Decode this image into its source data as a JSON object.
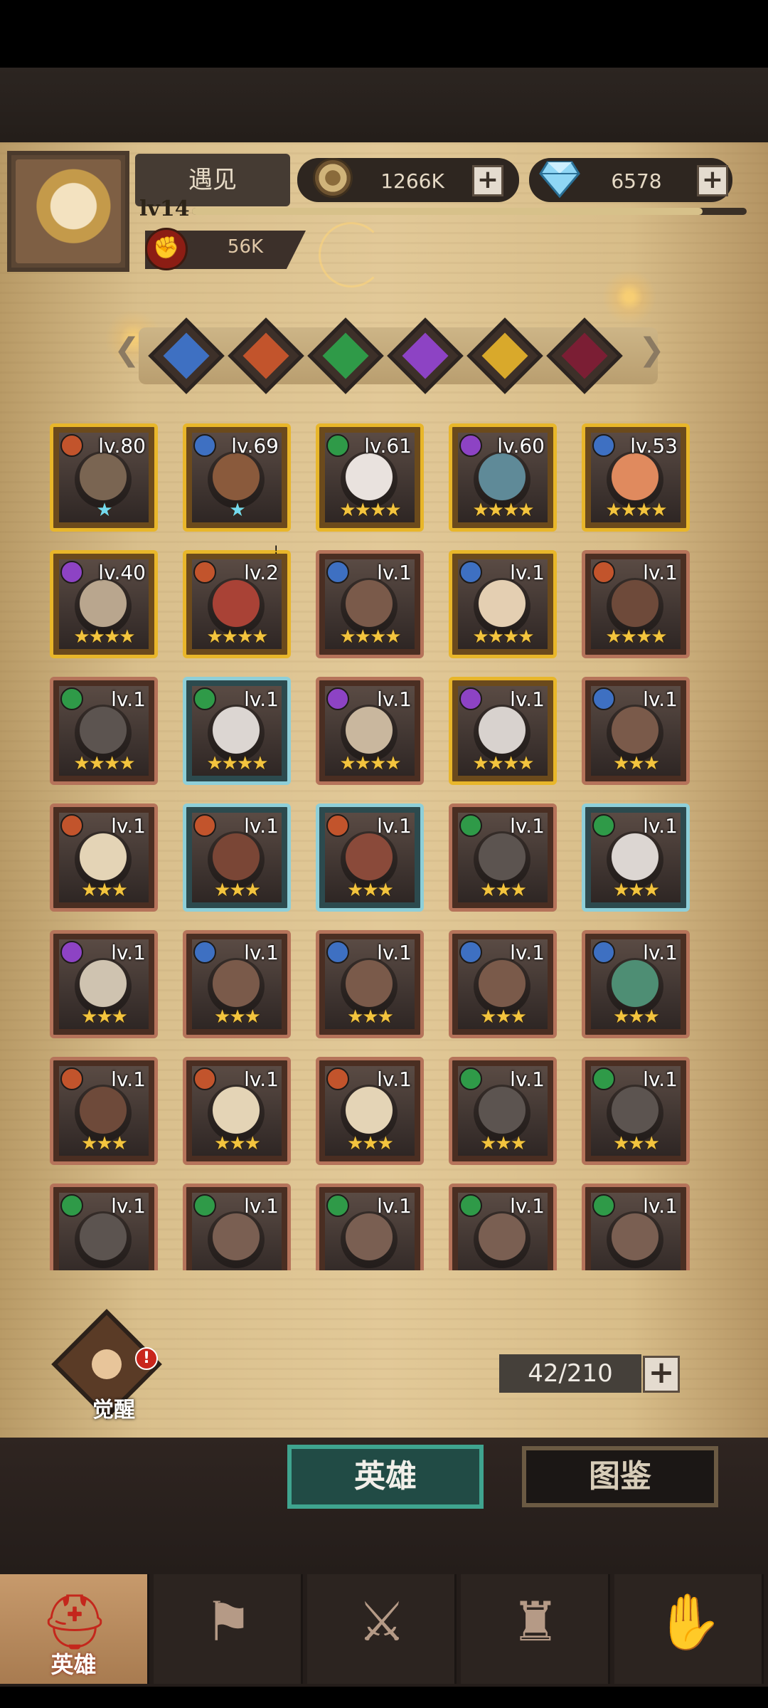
{
  "player": {
    "name": "遇见",
    "level": "lv14",
    "xp_fraction": 0.92,
    "power": "56K"
  },
  "resources": {
    "gold": "1266K",
    "gems": "6578",
    "plus": "+"
  },
  "filters": [
    {
      "name": "class-1",
      "color": "#3e70c2"
    },
    {
      "name": "class-2",
      "color": "#c2542c"
    },
    {
      "name": "class-3",
      "color": "#2f9a48"
    },
    {
      "name": "class-4",
      "color": "#8d43c4"
    },
    {
      "name": "class-5",
      "color": "#d9a92b"
    },
    {
      "name": "class-6",
      "color": "#7b1e34"
    }
  ],
  "heroes": [
    {
      "level": "lv.80",
      "stars": "★",
      "star_color": "blue",
      "frame": "gold",
      "cls": "#c2542c",
      "face": "#7a6552"
    },
    {
      "level": "lv.69",
      "stars": "★",
      "star_color": "blue",
      "frame": "gold",
      "cls": "#3e70c2",
      "face": "#8a5a3c"
    },
    {
      "level": "lv.61",
      "stars": "★★★★",
      "star_color": "gold",
      "frame": "gold",
      "cls": "#2f9a48",
      "face": "#e9e2de"
    },
    {
      "level": "lv.60",
      "stars": "★★★★",
      "star_color": "gold",
      "frame": "gold",
      "cls": "#8d43c4",
      "face": "#5f8a98"
    },
    {
      "level": "lv.53",
      "stars": "★★★★",
      "star_color": "gold",
      "frame": "gold",
      "cls": "#3e70c2",
      "face": "#e08a5e"
    },
    {
      "level": "lv.40",
      "stars": "★★★★",
      "star_color": "gold",
      "frame": "gold",
      "cls": "#8d43c4",
      "face": "#b9a68e"
    },
    {
      "level": "lv.2",
      "stars": "★★★★",
      "star_color": "gold",
      "frame": "gold",
      "cls": "#c2542c",
      "face": "#a94236",
      "badge": "!"
    },
    {
      "level": "lv.1",
      "stars": "★★★★",
      "star_color": "gold",
      "frame": "bronze",
      "cls": "#3e70c2",
      "face": "#7a5a4a"
    },
    {
      "level": "lv.1",
      "stars": "★★★★",
      "star_color": "gold",
      "frame": "gold",
      "cls": "#3e70c2",
      "face": "#e4cfb2"
    },
    {
      "level": "lv.1",
      "stars": "★★★★",
      "star_color": "gold",
      "frame": "bronze",
      "cls": "#c2542c",
      "face": "#6e4a3a"
    },
    {
      "level": "lv.1",
      "stars": "★★★★",
      "star_color": "gold",
      "frame": "bronze",
      "cls": "#2f9a48",
      "face": "#5c5450"
    },
    {
      "level": "lv.1",
      "stars": "★★★★",
      "star_color": "gold",
      "frame": "teal",
      "cls": "#2f9a48",
      "face": "#dcd6d2"
    },
    {
      "level": "lv.1",
      "stars": "★★★★",
      "star_color": "gold",
      "frame": "bronze",
      "cls": "#8d43c4",
      "face": "#c9b79e"
    },
    {
      "level": "lv.1",
      "stars": "★★★★",
      "star_color": "gold",
      "frame": "gold",
      "cls": "#8d43c4",
      "face": "#d8d2ce"
    },
    {
      "level": "lv.1",
      "stars": "★★★",
      "star_color": "gold",
      "frame": "bronze",
      "cls": "#3e70c2",
      "face": "#7a5a4a"
    },
    {
      "level": "lv.1",
      "stars": "★★★",
      "star_color": "gold",
      "frame": "bronze",
      "cls": "#c2542c",
      "face": "#e4d4b6"
    },
    {
      "level": "lv.1",
      "stars": "★★★",
      "star_color": "gold",
      "frame": "teal",
      "cls": "#c2542c",
      "face": "#7a4636"
    },
    {
      "level": "lv.1",
      "stars": "★★★",
      "star_color": "gold",
      "frame": "teal",
      "cls": "#c2542c",
      "face": "#8a4a3a"
    },
    {
      "level": "lv.1",
      "stars": "★★★",
      "star_color": "gold",
      "frame": "bronze",
      "cls": "#2f9a48",
      "face": "#5c5450"
    },
    {
      "level": "lv.1",
      "stars": "★★★",
      "star_color": "gold",
      "frame": "teal",
      "cls": "#2f9a48",
      "face": "#dcd6d2"
    },
    {
      "level": "lv.1",
      "stars": "★★★",
      "star_color": "gold",
      "frame": "bronze",
      "cls": "#8d43c4",
      "face": "#cfc3b0"
    },
    {
      "level": "lv.1",
      "stars": "★★★",
      "star_color": "gold",
      "frame": "bronze",
      "cls": "#3e70c2",
      "face": "#7a5a4a"
    },
    {
      "level": "lv.1",
      "stars": "★★★",
      "star_color": "gold",
      "frame": "bronze",
      "cls": "#3e70c2",
      "face": "#7a5a4a"
    },
    {
      "level": "lv.1",
      "stars": "★★★",
      "star_color": "gold",
      "frame": "bronze",
      "cls": "#3e70c2",
      "face": "#7a5a4a"
    },
    {
      "level": "lv.1",
      "stars": "★★★",
      "star_color": "gold",
      "frame": "bronze",
      "cls": "#3e70c2",
      "face": "#4e8e74"
    },
    {
      "level": "lv.1",
      "stars": "★★★",
      "star_color": "gold",
      "frame": "bronze",
      "cls": "#c2542c",
      "face": "#6e4a3a"
    },
    {
      "level": "lv.1",
      "stars": "★★★",
      "star_color": "gold",
      "frame": "bronze",
      "cls": "#c2542c",
      "face": "#e4d4b6"
    },
    {
      "level": "lv.1",
      "stars": "★★★",
      "star_color": "gold",
      "frame": "bronze",
      "cls": "#c2542c",
      "face": "#e4d4b6"
    },
    {
      "level": "lv.1",
      "stars": "★★★",
      "star_color": "gold",
      "frame": "bronze",
      "cls": "#2f9a48",
      "face": "#5c5450"
    },
    {
      "level": "lv.1",
      "stars": "★★★",
      "star_color": "gold",
      "frame": "bronze",
      "cls": "#2f9a48",
      "face": "#5c5450"
    },
    {
      "level": "lv.1",
      "stars": "",
      "star_color": "gold",
      "frame": "bronze",
      "cls": "#2f9a48",
      "face": "#5c5450"
    },
    {
      "level": "lv.1",
      "stars": "",
      "star_color": "gold",
      "frame": "bronze",
      "cls": "#2f9a48",
      "face": "#7a5f52"
    },
    {
      "level": "lv.1",
      "stars": "",
      "star_color": "gold",
      "frame": "bronze",
      "cls": "#2f9a48",
      "face": "#7a5f52"
    },
    {
      "level": "lv.1",
      "stars": "",
      "star_color": "gold",
      "frame": "bronze",
      "cls": "#2f9a48",
      "face": "#7a5f52"
    },
    {
      "level": "lv.1",
      "stars": "",
      "star_color": "gold",
      "frame": "bronze",
      "cls": "#2f9a48",
      "face": "#7a5f52"
    }
  ],
  "awaken": {
    "label": "觉醒",
    "badge": "!"
  },
  "hero_count": "42/210",
  "tabs": {
    "heroes": "英雄",
    "guide": "图鉴"
  },
  "nav": [
    {
      "name": "nav-heroes",
      "label": "英雄",
      "active": true
    },
    {
      "name": "nav-adventure",
      "label": "",
      "active": false
    },
    {
      "name": "nav-battle",
      "label": "",
      "active": false
    },
    {
      "name": "nav-castle",
      "label": "",
      "active": false
    },
    {
      "name": "nav-guild",
      "label": "",
      "active": false
    }
  ]
}
